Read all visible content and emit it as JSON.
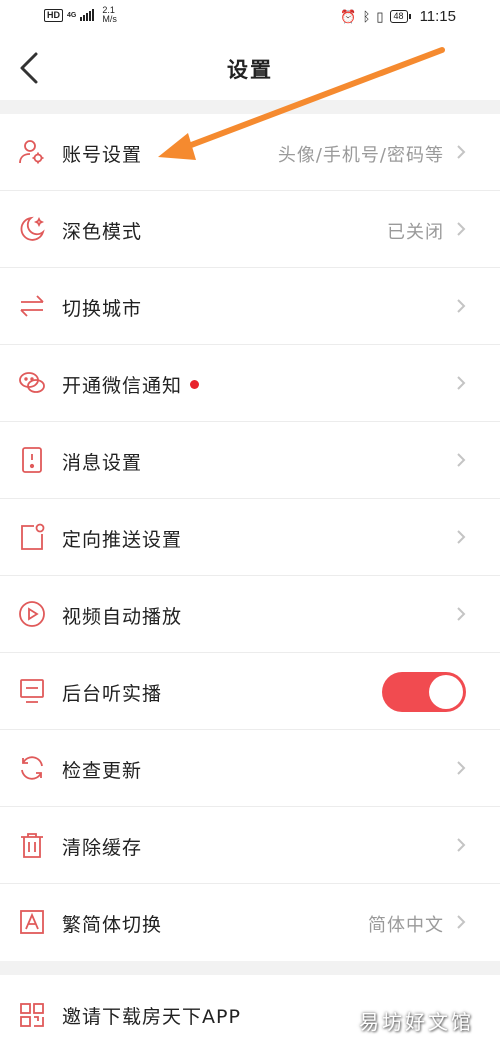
{
  "status_bar": {
    "hd": "HD",
    "network": "4G",
    "speed_value": "2.1",
    "speed_unit": "M/s",
    "battery": "48",
    "time": "11:15"
  },
  "header": {
    "title": "设置",
    "back_icon": "chevron-left-icon"
  },
  "colors": {
    "accent": "#e8232d",
    "toggle_on": "#f14b50",
    "icon_red": "#e05a5a",
    "arrow_orange": "#f58a2f"
  },
  "settings": [
    {
      "label": "账号设置",
      "value": "头像/手机号/密码等",
      "icon": "user-gear-icon"
    },
    {
      "label": "深色模式",
      "value": "已关闭",
      "icon": "moon-icon"
    },
    {
      "label": "切换城市",
      "value": "",
      "icon": "swap-arrows-icon"
    },
    {
      "label": "开通微信通知",
      "value": "",
      "icon": "wechat-icon",
      "badge": "red-dot"
    },
    {
      "label": "消息设置",
      "value": "",
      "icon": "message-bell-icon"
    },
    {
      "label": "定向推送设置",
      "value": "",
      "icon": "push-icon"
    },
    {
      "label": "视频自动播放",
      "value": "",
      "icon": "play-circle-icon"
    },
    {
      "label": "后台听实播",
      "value": "",
      "icon": "monitor-icon",
      "toggle": true
    },
    {
      "label": "检查更新",
      "value": "",
      "icon": "refresh-icon"
    },
    {
      "label": "清除缓存",
      "value": "",
      "icon": "trash-icon"
    },
    {
      "label": "繁简体切换",
      "value": "简体中文",
      "icon": "font-a-icon"
    }
  ],
  "invite": {
    "label": "邀请下载房天下APP",
    "icon": "qr-code-icon"
  },
  "watermark": "易坊好文馆"
}
